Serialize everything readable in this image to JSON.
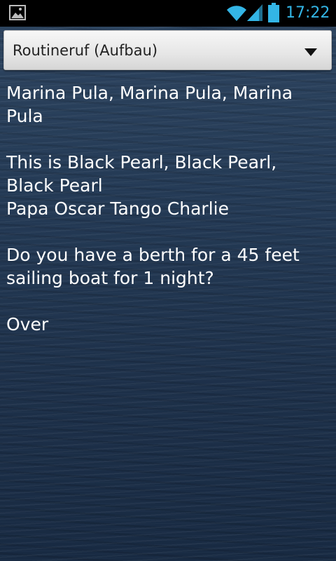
{
  "status_bar": {
    "notification_icon": "gallery-picture-icon",
    "wifi_icon": "wifi-icon",
    "signal_icon": "cell-signal-icon",
    "battery_icon": "battery-icon",
    "time": "17:22",
    "time_color": "#33b5e5"
  },
  "spinner": {
    "selected": "Routineruf (Aufbau)",
    "arrow_icon": "dropdown-arrow-icon"
  },
  "message": {
    "call": "Marina Pula, Marina Pula, Marina Pula",
    "identification": "This is Black Pearl, Black Pearl, Black Pearl",
    "callsign": "Papa Oscar Tango Charlie",
    "request": "Do you have a berth for a 45 feet sailing boat for 1 night?",
    "closing": "Over"
  }
}
